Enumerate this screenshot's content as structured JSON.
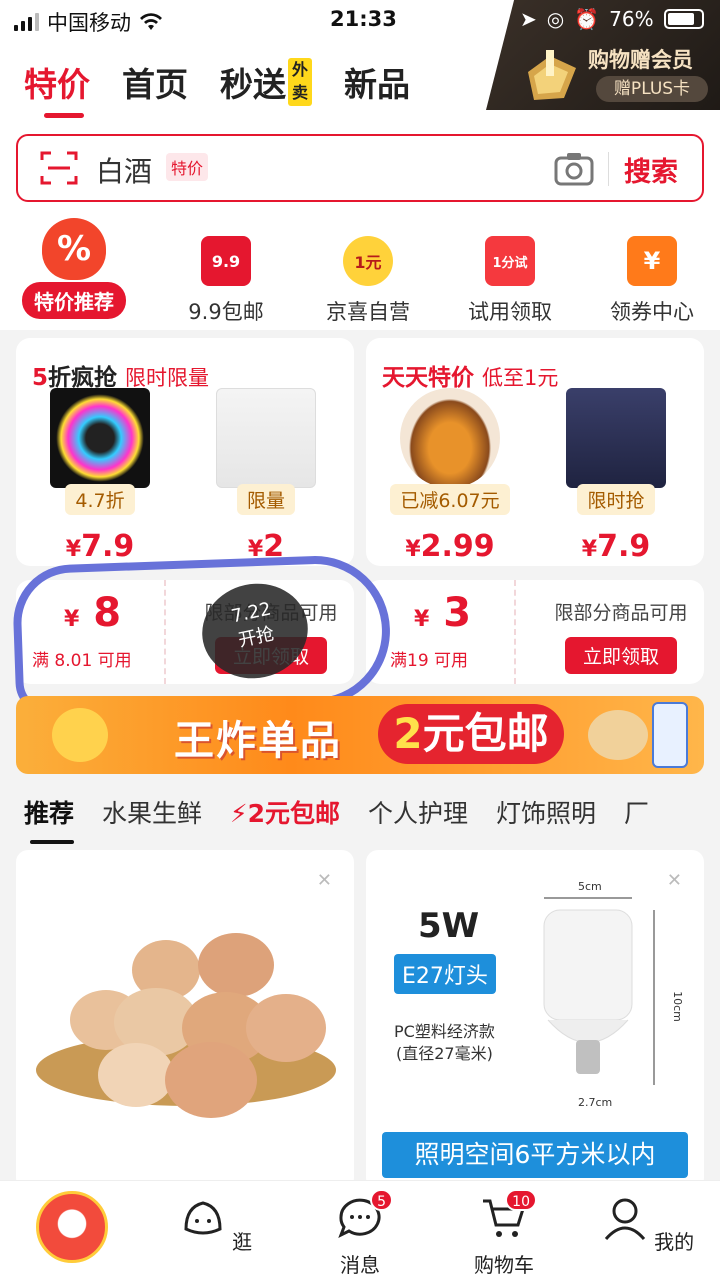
{
  "status": {
    "carrier": "中国移动",
    "time": "21:33",
    "battery": "76%"
  },
  "vip": {
    "title": "购物赠会员",
    "sub": "赠PLUS卡"
  },
  "nav": {
    "tabs": [
      "特价",
      "首页",
      "秒送",
      "新品"
    ],
    "waimai": "外卖"
  },
  "search": {
    "value": "白酒",
    "tag": "特价",
    "button": "搜索"
  },
  "categories": [
    "特价推荐",
    "9.9包邮",
    "京喜自营",
    "试用领取",
    "领券中心"
  ],
  "category_icons": {
    "c1": "9.9",
    "c2": "1元",
    "c3": "1分试",
    "c4": "¥"
  },
  "promo_left": {
    "title_red": "5",
    "title_rest": "折疯抢",
    "sub": "限时限量",
    "products": [
      {
        "tag": "4.7折",
        "currency": "¥",
        "price": "7.9"
      },
      {
        "tag": "限量",
        "currency": "¥",
        "price": "2"
      }
    ]
  },
  "promo_right": {
    "title_red": "天天",
    "title_rest": "特价",
    "sub": "低至1元",
    "products": [
      {
        "tag": "已减6.07元",
        "currency": "¥",
        "price": "2.99"
      },
      {
        "tag": "限时抢",
        "currency": "¥",
        "price": "7.9"
      }
    ]
  },
  "coupons": [
    {
      "currency": "¥",
      "amount": "8",
      "condition": "满 8.01 可用",
      "note": "限部分商品可用",
      "button": "立即领取"
    },
    {
      "currency": "¥",
      "amount": "3",
      "condition": "满19 可用",
      "note": "限部分商品可用",
      "button": "立即领取"
    }
  ],
  "overlay_badge": {
    "line1": "7.22",
    "line2": "开抢"
  },
  "banner": {
    "text": "王炸单品",
    "pill_num": "2",
    "pill_text": "元包邮"
  },
  "feed_tabs": [
    "推荐",
    "水果生鲜",
    "2元包邮",
    "个人护理",
    "灯饰照明",
    "厂"
  ],
  "feed": {
    "bulb_watt": "5W",
    "bulb_base": "E27灯头",
    "bulb_desc1": "PC塑料经济款",
    "bulb_desc2": "(直径27毫米)",
    "bulb_w": "5cm",
    "bulb_h": "10cm",
    "bulb_d": "2.7cm",
    "bulb_banner": "照明空间6平方米以内"
  },
  "bottom_nav": [
    {
      "label": "",
      "badge": ""
    },
    {
      "label": "逛",
      "badge": ""
    },
    {
      "label": "消息",
      "badge": "5"
    },
    {
      "label": "购物车",
      "badge": "10"
    },
    {
      "label": "我的",
      "badge": ""
    }
  ],
  "colors": {
    "brand_red": "#e5172f",
    "vip_gold": "#f6e2c2"
  }
}
